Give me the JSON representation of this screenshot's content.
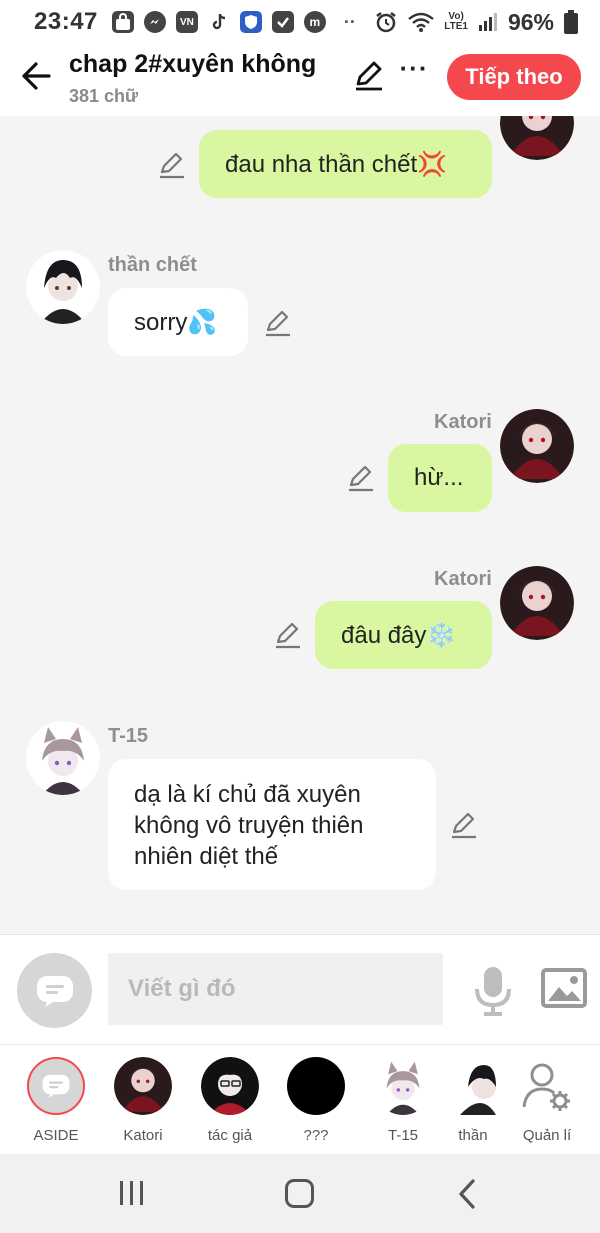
{
  "status_bar": {
    "time": "23:47",
    "battery": "96%",
    "network": "LTE1",
    "app_icons": [
      "shopping-bag-icon",
      "messenger-icon",
      "vn-icon",
      "tiktok-icon",
      "shield-icon",
      "check-icon",
      "m-icon"
    ]
  },
  "header": {
    "title": "chap 2#xuyên không",
    "subtitle": "381 chữ",
    "next_label": "Tiếp theo",
    "accent_color": "#f4484e"
  },
  "messages": [
    {
      "sender": "Katori",
      "side": "right",
      "text": "đau nha thần chết💢",
      "sender_visible": false
    },
    {
      "sender": "thần chết",
      "side": "left",
      "text": "sorry💦"
    },
    {
      "sender": "Katori",
      "side": "right",
      "text": "hừ..."
    },
    {
      "sender": "Katori",
      "side": "right",
      "text": "đâu đây❄️"
    },
    {
      "sender": "T-15",
      "side": "left",
      "text_lines": [
        "dạ là kí chủ đã xuyên",
        "không vô truyện thiên",
        "nhiên diệt thế"
      ]
    }
  ],
  "input": {
    "placeholder": "Viết gì đó"
  },
  "characters": [
    {
      "label": "ASIDE"
    },
    {
      "label": "Katori"
    },
    {
      "label": "tác giả"
    },
    {
      "label": "???"
    },
    {
      "label": "T-15"
    },
    {
      "label": "thần"
    },
    {
      "label": "Quản lí"
    }
  ],
  "colors": {
    "my_bubble": "#d8f7a0",
    "other_bubble": "#ffffff",
    "chat_bg": "#f4f4f4"
  }
}
